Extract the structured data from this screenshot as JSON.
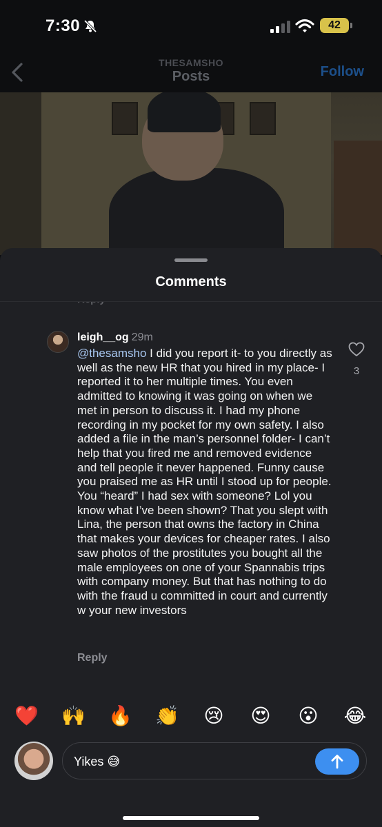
{
  "status_bar": {
    "time": "7:30",
    "battery": "42",
    "icons": [
      "bell-slash-icon",
      "signal-icon",
      "wifi-icon",
      "battery-icon"
    ]
  },
  "nav": {
    "handle": "THESAMSHO",
    "title": "Posts",
    "follow_label": "Follow",
    "back_icon": "chevron-left-icon"
  },
  "sheet": {
    "title": "Comments",
    "prev_reply_label": "Reply"
  },
  "comment": {
    "username": "leigh__og",
    "time": "29m",
    "mention": "@thesamsho",
    "text": " I did you report it- to you directly as well as the new HR that you hired in my place- I reported it to her multiple times. You even admitted to knowing it was going on when we met in person to discuss it. I had my phone recording in my pocket for my own safety. I also added a file in the man’s personnel folder- I can’t help that you fired me and removed evidence and tell people it never happened. Funny cause you praised me as HR until I stood up for people. You “heard” I had sex with someone? Lol you know what I’ve been shown? That you slept with Lina, the person that owns the factory in China that makes your devices for cheaper rates. I also saw photos of the prostitutes you bought all the male employees on one of your Spannabis trips with company money. But that has nothing to do with the fraud u committed in court and currently w your new investors",
    "likes": "3",
    "reply_label": "Reply"
  },
  "emoji_bar": [
    "❤️",
    "🙌",
    "🔥",
    "👏",
    "😢",
    "😍",
    "😮",
    "😂"
  ],
  "composer": {
    "value": "Yikes 😅",
    "send_icon": "arrow-up-icon"
  },
  "colors": {
    "sheet_bg": "#1f2024",
    "mention": "#a9c8f2",
    "send_button": "#3d8ff0",
    "follow": "#1c4f8a"
  }
}
